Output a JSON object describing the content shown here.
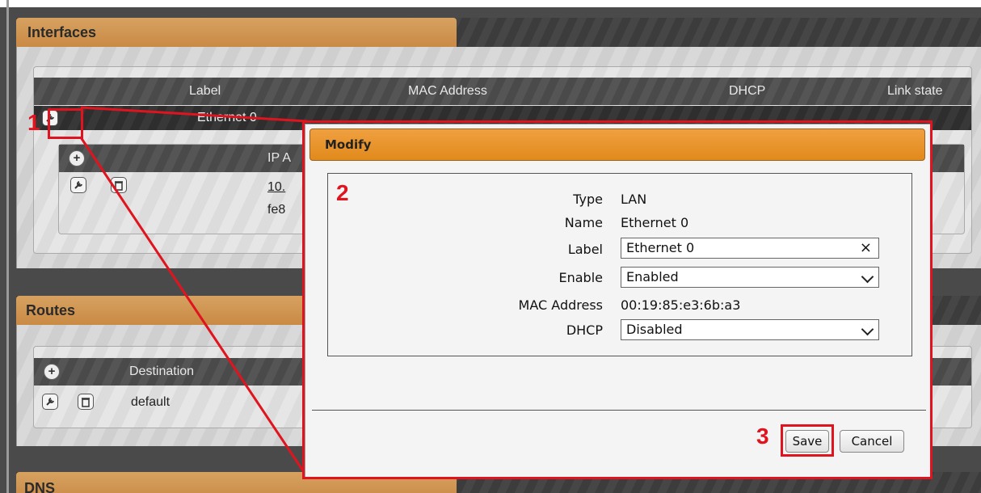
{
  "sections": {
    "interfaces": {
      "title": "Interfaces",
      "columns": [
        "Label",
        "MAC Address",
        "DHCP",
        "Link state"
      ],
      "row": {
        "label": "Ethernet 0"
      },
      "ip_header": "IP A",
      "ip_rows": [
        "10.",
        "fe8"
      ]
    },
    "routes": {
      "title": "Routes",
      "columns": [
        "Destination"
      ],
      "rows": [
        "default"
      ]
    },
    "dns": {
      "title": "DNS"
    }
  },
  "modal": {
    "title": "Modify",
    "fields": {
      "type_label": "Type",
      "type_value": "LAN",
      "name_label": "Name",
      "name_value": "Ethernet 0",
      "label_label": "Label",
      "label_value": "Ethernet 0",
      "enable_label": "Enable",
      "enable_value": "Enabled",
      "mac_label": "MAC Address",
      "mac_value": "00:19:85:e3:6b:a3",
      "dhcp_label": "DHCP",
      "dhcp_value": "Disabled"
    },
    "save_label": "Save",
    "cancel_label": "Cancel"
  },
  "callouts": [
    "1",
    "2",
    "3"
  ],
  "icons": {
    "clear": "×",
    "add": "+",
    "edit": "wrench-icon",
    "delete": "trash-icon"
  },
  "colors": {
    "accent": "#e18a1c",
    "section_tab": "#d19a55",
    "callout_red": "#e0141e"
  }
}
